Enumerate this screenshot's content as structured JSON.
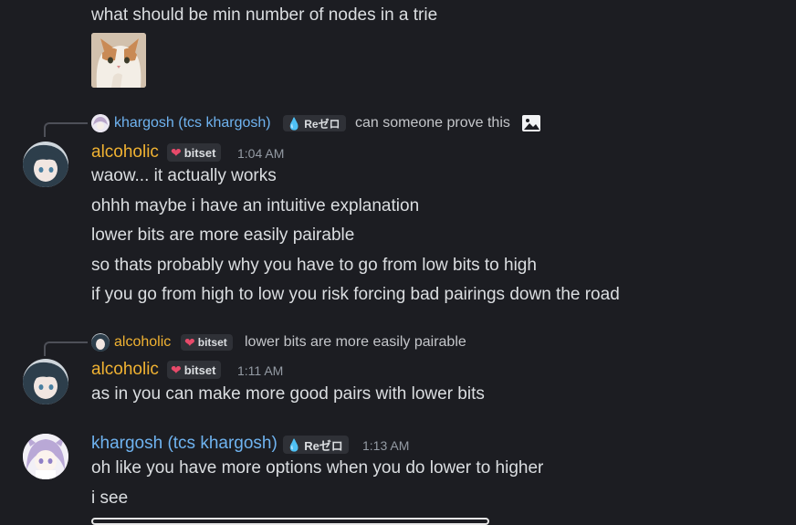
{
  "messages": {
    "m1": {
      "text": "what should be min number of nodes in a trie"
    },
    "reply1": {
      "author": "khargosh (tcs khargosh)",
      "tag": "Reゼロ",
      "text": "can someone prove this"
    },
    "g1": {
      "author": "alcoholic",
      "tag": "bitset",
      "time": "1:04 AM",
      "lines": [
        "waow... it actually works",
        "ohhh maybe i have an intuitive explanation",
        "lower bits are more easily pairable",
        "so thats probably why you have to go from low bits to high",
        "if you go from high to low you risk forcing bad pairings down the road"
      ]
    },
    "reply2": {
      "author": "alcoholic",
      "tag": "bitset",
      "text": "lower bits are more easily pairable"
    },
    "g2": {
      "author": "alcoholic",
      "tag": "bitset",
      "time": "1:11 AM",
      "lines": [
        "as in you can make more good pairs with lower bits"
      ]
    },
    "g3": {
      "author": "khargosh (tcs khargosh)",
      "tag": "Reゼロ",
      "time": "1:13 AM",
      "lines": [
        "oh like you have more options when you do lower to higher",
        "i see"
      ]
    }
  },
  "icons": {
    "tag_bitset": "heart-icon",
    "tag_re": "droplet-icon",
    "attachment": "image-icon"
  },
  "colors": {
    "background": "#1c1d22",
    "alcoholic_name": "#f0b232",
    "khargosh_name": "#6fb3f0",
    "text": "#dbdee1",
    "timestamp": "#949ba4"
  }
}
